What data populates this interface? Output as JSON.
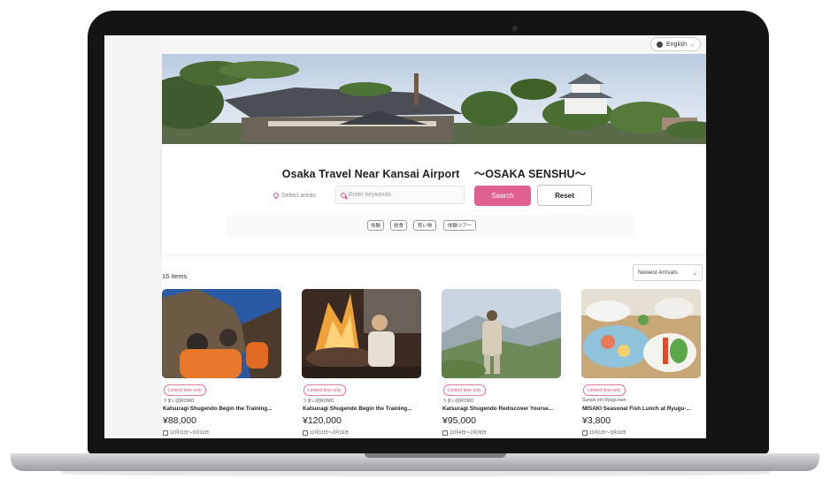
{
  "header": {
    "language_label": "English"
  },
  "hero": {
    "title": "Osaka Travel Near Kansai Airport 　〜OSAKA SENSHU〜"
  },
  "search": {
    "area_placeholder": "Select areas",
    "keyword_placeholder": "Enter keywords",
    "search_label": "Search",
    "reset_label": "Reset",
    "tags": [
      "体験",
      "飲食",
      "買い物",
      "体験ツアー"
    ]
  },
  "listing": {
    "count_label": "16 items",
    "sort_selected": "Newest Arrivals",
    "items": [
      {
        "badge": "Limited time only",
        "shop": "うまい店ROMO",
        "name": "Katsuragi Shugendo Begin the Training...",
        "price": "¥88,000",
        "dates": "12月11日〜2月16日"
      },
      {
        "badge": "Limited time only",
        "shop": "うまい店ROMO",
        "name": "Katsuragi Shugendo Begin the Training...",
        "price": "¥120,000",
        "dates": "12月11日〜2月16日"
      },
      {
        "badge": "Limited time only",
        "shop": "うまい店ROMO",
        "name": "Katsuragi Shugendo Rediscover Yourse...",
        "price": "¥95,000",
        "dates": "12月4日〜2月28日"
      },
      {
        "badge": "Limited time only",
        "shop": "Sunset Inn Ryugu-kan",
        "name": "MISAKI Seasonal Fish Lunch at Ryugu-...",
        "price": "¥3,800",
        "dates": "10月1日〜3月31日"
      }
    ]
  },
  "colors": {
    "accent": "#e06090",
    "bezel": "#141414"
  }
}
